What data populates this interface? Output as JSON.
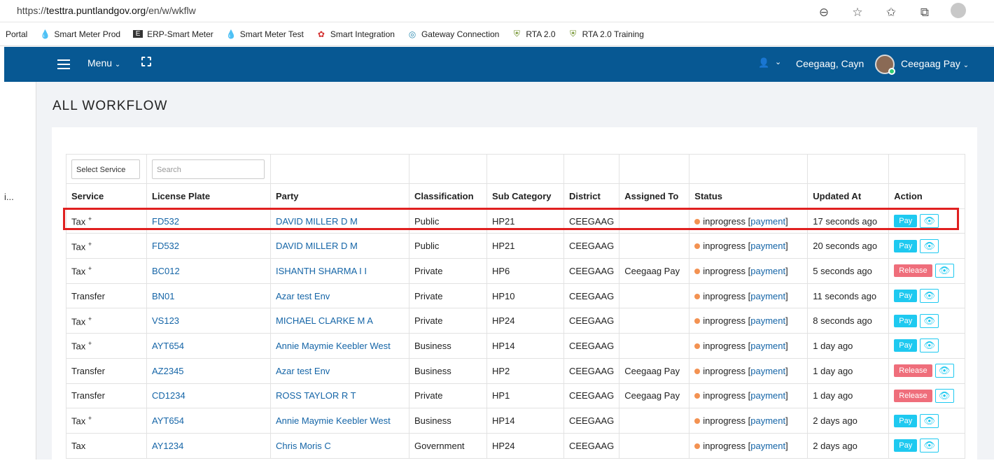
{
  "browser": {
    "url_prefix": "https://",
    "url_host": "testtra.puntlandgov.org",
    "url_path": "/en/w/wkflw",
    "icons": [
      "zoom-icon",
      "favorite-add-icon",
      "favorites-icon",
      "collections-icon",
      "profile-icon"
    ]
  },
  "bookmarks": [
    {
      "label": "Portal",
      "icon": ""
    },
    {
      "label": "Smart Meter Prod",
      "icon": "droplet-icon"
    },
    {
      "label": "ERP-Smart Meter",
      "icon": "e-logo-icon"
    },
    {
      "label": "Smart Meter Test",
      "icon": "droplet-icon"
    },
    {
      "label": "Smart Integration",
      "icon": "huawei-logo-icon"
    },
    {
      "label": "Gateway Connection",
      "icon": "gateway-logo-icon"
    },
    {
      "label": "RTA 2.0",
      "icon": "emblem-icon"
    },
    {
      "label": "RTA 2.0 Training",
      "icon": "emblem-icon"
    }
  ],
  "navbar": {
    "menu_label": "Menu",
    "user_name": "Ceegaag, Cayn",
    "account_name": "Ceegaag Pay",
    "bg_color": "#075893"
  },
  "left_strip_fragment": "i...",
  "page": {
    "title": "ALL WORKFLOW"
  },
  "filters": {
    "service_select": "Select Service",
    "search_placeholder": "Search"
  },
  "table": {
    "headers": [
      "Service",
      "License Plate",
      "Party",
      "Classification",
      "Sub Category",
      "District",
      "Assigned To",
      "Status",
      "Updated At",
      "Action"
    ],
    "rows": [
      {
        "service": "Tax",
        "plus": true,
        "plate": "FD532",
        "party": "DAVID MILLER D M",
        "classification": "Public",
        "sub": "HP21",
        "district": "CEEGAAG",
        "assigned": "",
        "status": "inprogress",
        "status_link": "payment",
        "updated": "17 seconds ago",
        "action": "Pay"
      },
      {
        "service": "Tax",
        "plus": true,
        "plate": "FD532",
        "party": "DAVID MILLER D M",
        "classification": "Public",
        "sub": "HP21",
        "district": "CEEGAAG",
        "assigned": "",
        "status": "inprogress",
        "status_link": "payment",
        "updated": "20 seconds ago",
        "action": "Pay"
      },
      {
        "service": "Tax",
        "plus": true,
        "plate": "BC012",
        "party": "ISHANTH SHARMA I I",
        "classification": "Private",
        "sub": "HP6",
        "district": "CEEGAAG",
        "assigned": "Ceegaag Pay",
        "status": "inprogress",
        "status_link": "payment",
        "updated": "5 seconds ago",
        "action": "Release"
      },
      {
        "service": "Transfer",
        "plus": false,
        "plate": "BN01",
        "party": "Azar test Env",
        "classification": "Private",
        "sub": "HP10",
        "district": "CEEGAAG",
        "assigned": "",
        "status": "inprogress",
        "status_link": "payment",
        "updated": "11 seconds ago",
        "action": "Pay"
      },
      {
        "service": "Tax",
        "plus": true,
        "plate": "VS123",
        "party": "MICHAEL CLARKE M A",
        "classification": "Private",
        "sub": "HP24",
        "district": "CEEGAAG",
        "assigned": "",
        "status": "inprogress",
        "status_link": "payment",
        "updated": "8 seconds ago",
        "action": "Pay"
      },
      {
        "service": "Tax",
        "plus": true,
        "plate": "AYT654",
        "party": "Annie Maymie Keebler West",
        "classification": "Business",
        "sub": "HP14",
        "district": "CEEGAAG",
        "assigned": "",
        "status": "inprogress",
        "status_link": "payment",
        "updated": "1 day ago",
        "action": "Pay"
      },
      {
        "service": "Transfer",
        "plus": false,
        "plate": "AZ2345",
        "party": "Azar test Env",
        "classification": "Business",
        "sub": "HP2",
        "district": "CEEGAAG",
        "assigned": "Ceegaag Pay",
        "status": "inprogress",
        "status_link": "payment",
        "updated": "1 day ago",
        "action": "Release"
      },
      {
        "service": "Transfer",
        "plus": false,
        "plate": "CD1234",
        "party": "ROSS TAYLOR R T",
        "classification": "Private",
        "sub": "HP1",
        "district": "CEEGAAG",
        "assigned": "Ceegaag Pay",
        "status": "inprogress",
        "status_link": "payment",
        "updated": "1 day ago",
        "action": "Release"
      },
      {
        "service": "Tax",
        "plus": true,
        "plate": "AYT654",
        "party": "Annie Maymie Keebler West",
        "classification": "Business",
        "sub": "HP14",
        "district": "CEEGAAG",
        "assigned": "",
        "status": "inprogress",
        "status_link": "payment",
        "updated": "2 days ago",
        "action": "Pay"
      },
      {
        "service": "Tax",
        "plus": false,
        "plate": "AY1234",
        "party": "Chris Moris C",
        "classification": "Government",
        "sub": "HP24",
        "district": "CEEGAAG",
        "assigned": "",
        "status": "inprogress",
        "status_link": "payment",
        "updated": "2 days ago",
        "action": "Pay"
      }
    ]
  },
  "colors": {
    "link": "#1565a7",
    "pay_button": "#1ec9f0",
    "release_button": "#ef6e7b",
    "status_dot": "#f39252",
    "highlight": "#e02020"
  }
}
